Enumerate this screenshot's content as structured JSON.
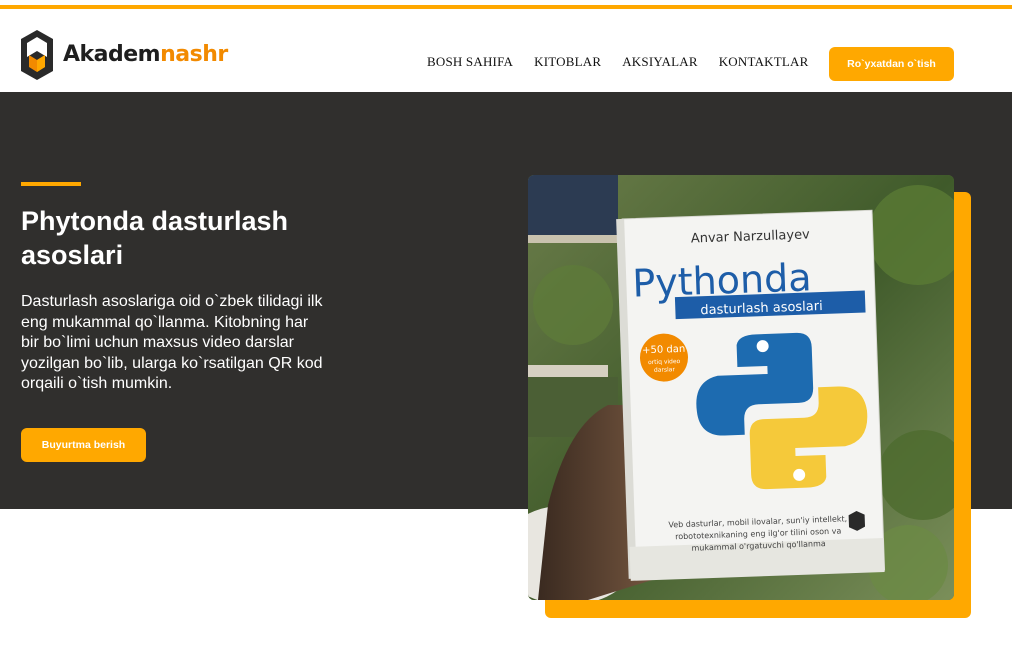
{
  "brand": {
    "name_dark": "Akadem",
    "name_accent": "nashr",
    "logo_icon": "book-hexagon-logo",
    "accent_color": "#ffa800",
    "brand_orange": "#f28a00"
  },
  "nav": {
    "items": [
      {
        "label": "BOSH SAHIFA"
      },
      {
        "label": "KITOBLAR"
      },
      {
        "label": "AKSIYALAR"
      },
      {
        "label": "KONTAKTLAR"
      }
    ],
    "register_label": "Ro`yxatdan o`tish"
  },
  "hero": {
    "title": "Phytonda dasturlash asoslari",
    "description": "Dasturlash asoslariga oid o`zbek tilidagi ilk eng mukammal qo`llanma. Kitobning har bir bo`limi uchun maxsus video darslar yozilgan bo`lib, ularga ko`rsatilgan QR kod orqaili o`tish mumkin.",
    "order_label": "Buyurtma berish",
    "background_color": "#302f2d"
  },
  "book": {
    "author": "Anvar Narzullayev",
    "title": "Pythonda",
    "subtitle": "dasturlash asoslari",
    "badge_line1": "+50 dan",
    "badge_line2": "ortiq video",
    "badge_line3": "darslar",
    "footer_line1": "Veb dasturlar, mobil ilovalar, sun'iy intellekt,",
    "footer_line2": "robototexnikaning eng ilg'or tilini oson va",
    "footer_line3": "mukammal o'rgatuvchi qo'llanma"
  }
}
